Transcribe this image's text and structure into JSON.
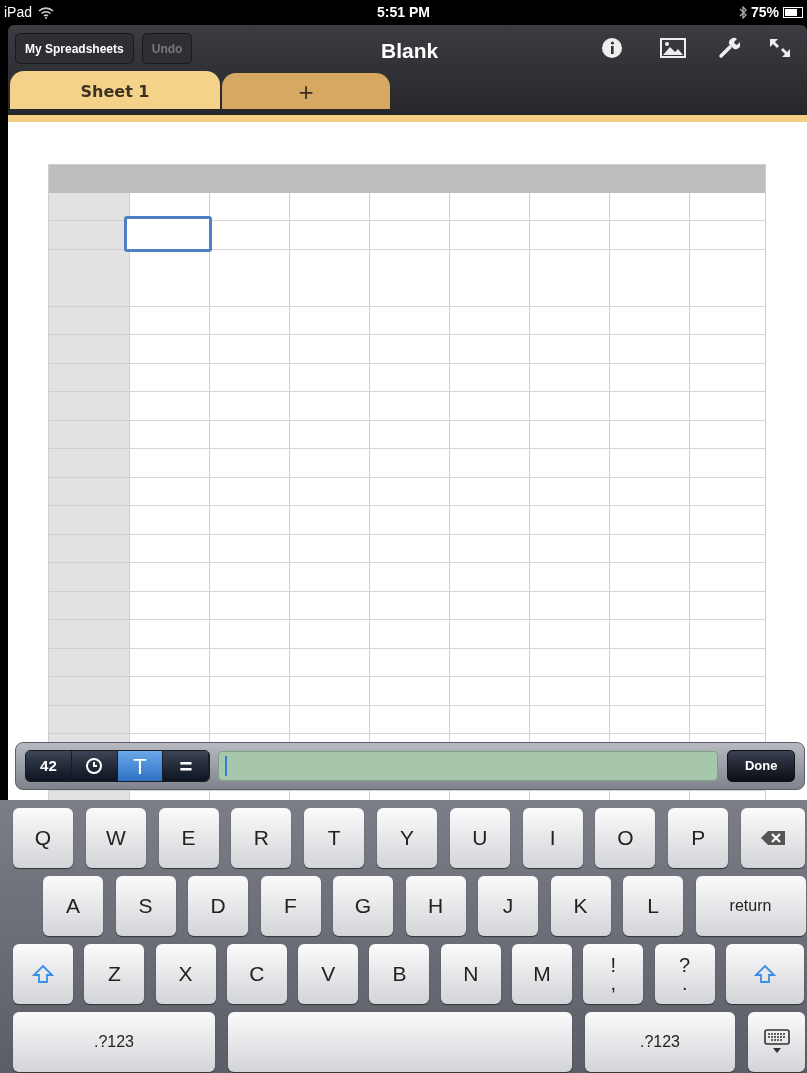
{
  "status_bar": {
    "device": "iPad",
    "time": "5:51 PM",
    "battery": "75%"
  },
  "toolbar": {
    "buttons": [
      {
        "label": "My Spreadsheets",
        "disabled": false
      },
      {
        "label": "Undo",
        "disabled": true
      }
    ],
    "title": "Blank"
  },
  "tabs": [
    {
      "label": "Sheet 1",
      "selected": true
    },
    {
      "label": "+",
      "selected": false
    }
  ],
  "input_bar": {
    "modes": [
      {
        "kind": "number",
        "label": "42",
        "selected": false
      },
      {
        "kind": "clock",
        "selected": false
      },
      {
        "kind": "text",
        "label": "T",
        "selected": true
      },
      {
        "kind": "formula",
        "label": "=",
        "selected": false
      }
    ],
    "done": "Done"
  },
  "keyboard": {
    "rows": [
      {
        "keys": [
          {
            "kind": "key",
            "label": "Q"
          },
          {
            "kind": "key",
            "label": "W"
          },
          {
            "kind": "key",
            "label": "E"
          },
          {
            "kind": "key",
            "label": "R"
          },
          {
            "kind": "key",
            "label": "T"
          },
          {
            "kind": "key",
            "label": "Y"
          },
          {
            "kind": "key",
            "label": "U"
          },
          {
            "kind": "key",
            "label": "I"
          },
          {
            "kind": "key",
            "label": "O"
          },
          {
            "kind": "key",
            "label": "P"
          },
          {
            "kind": "backspace"
          }
        ]
      },
      {
        "keys": [
          {
            "kind": "key",
            "label": "A"
          },
          {
            "kind": "key",
            "label": "S"
          },
          {
            "kind": "key",
            "label": "D"
          },
          {
            "kind": "key",
            "label": "F"
          },
          {
            "kind": "key",
            "label": "G"
          },
          {
            "kind": "key",
            "label": "H"
          },
          {
            "kind": "key",
            "label": "J"
          },
          {
            "kind": "key",
            "label": "K"
          },
          {
            "kind": "key",
            "label": "L"
          },
          {
            "kind": "wide",
            "label": "return"
          }
        ]
      },
      {
        "keys": [
          {
            "kind": "shift"
          },
          {
            "kind": "key",
            "label": "Z"
          },
          {
            "kind": "key",
            "label": "X"
          },
          {
            "kind": "key",
            "label": "C"
          },
          {
            "kind": "key",
            "label": "V"
          },
          {
            "kind": "key",
            "label": "B"
          },
          {
            "kind": "key",
            "label": "N"
          },
          {
            "kind": "key",
            "label": "M"
          },
          {
            "kind": "key",
            "label": "!",
            "sublabel": ","
          },
          {
            "kind": "key",
            "label": "?",
            "sublabel": "."
          },
          {
            "kind": "shift"
          }
        ]
      },
      {
        "keys": [
          {
            "kind": "numbers",
            "label": ".?123"
          },
          {
            "kind": "space"
          },
          {
            "kind": "numbers2",
            "label": ".?123"
          },
          {
            "kind": "dismiss"
          }
        ]
      }
    ]
  }
}
